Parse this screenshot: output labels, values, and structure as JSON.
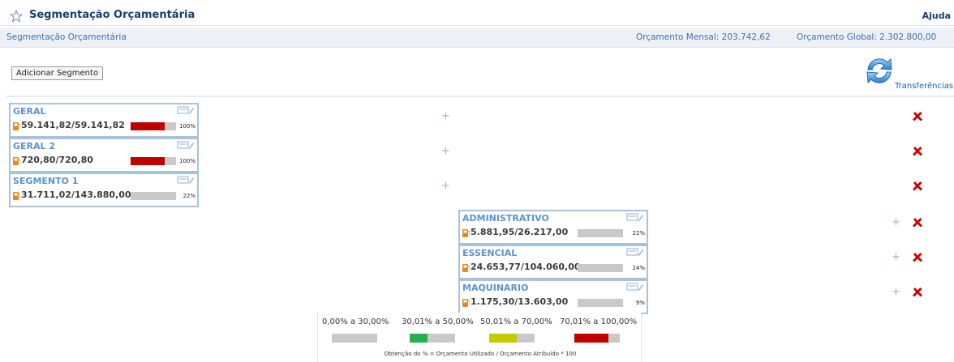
{
  "header": {
    "title": "Segmentação Orçamentária",
    "help": "Ajuda"
  },
  "infobar": {
    "breadcrumb": "Segmentação Orçamentária",
    "monthly_budget": "Orçamento Mensal: 203.742,62",
    "global_budget": "Orçamento Global: 2.302.800,00"
  },
  "toolbar": {
    "add_segment": "Adicionar Segmento",
    "transfers": "Transferências"
  },
  "segments": [
    {
      "name": "GERAL",
      "amount": "59.141,82/59.141,82",
      "percent_label": "100%",
      "percent": 100,
      "level": "red"
    },
    {
      "name": "GERAL 2",
      "amount": "720,80/720,80",
      "percent_label": "100%",
      "percent": 100,
      "level": "red"
    },
    {
      "name": "SEGMENTO 1",
      "amount": "31.711,02/143.880,00",
      "percent_label": "22%",
      "percent": 22,
      "level": "gray"
    }
  ],
  "subsegments": [
    {
      "name": "ADMINISTRATIVO",
      "amount": "5.881,95/26.217,00",
      "percent_label": "22%",
      "percent": 22,
      "level": "gray"
    },
    {
      "name": "ESSENCIAL",
      "amount": "24.653,77/104.060,00",
      "percent_label": "24%",
      "percent": 24,
      "level": "gray"
    },
    {
      "name": "MAQUINARIO",
      "amount": "1.175,30/13.603,00",
      "percent_label": "9%",
      "percent": 9,
      "level": "gray"
    }
  ],
  "controls": {
    "add": "+"
  },
  "legend": {
    "ranges": [
      {
        "label": "0,00% a 30,00%",
        "fill": 0,
        "color": "#c9c9c9"
      },
      {
        "label": "30,01% a 50,00%",
        "fill": 40,
        "color": "#22b14c"
      },
      {
        "label": "50,01% a 70,00%",
        "fill": 60,
        "color": "#c8c800"
      },
      {
        "label": "70,01% a 100,00%",
        "fill": 75,
        "color": "#c00000"
      }
    ],
    "formula": "Obtenção do % = Orçamento Utilizado / Orçamento Atribuído * 100"
  },
  "colors": {
    "title": "#163f6e",
    "link": "#3f6fa8",
    "card_border": "#a8c2dc",
    "card_name": "#5a93cf",
    "bar_red": "#c00000",
    "bar_empty": "#c9c9c9",
    "delete": "#cc0000"
  },
  "icons": [
    "star-icon",
    "transfer-icon",
    "edit-icon",
    "fuel-icon",
    "plus-icon",
    "delete-icon"
  ]
}
